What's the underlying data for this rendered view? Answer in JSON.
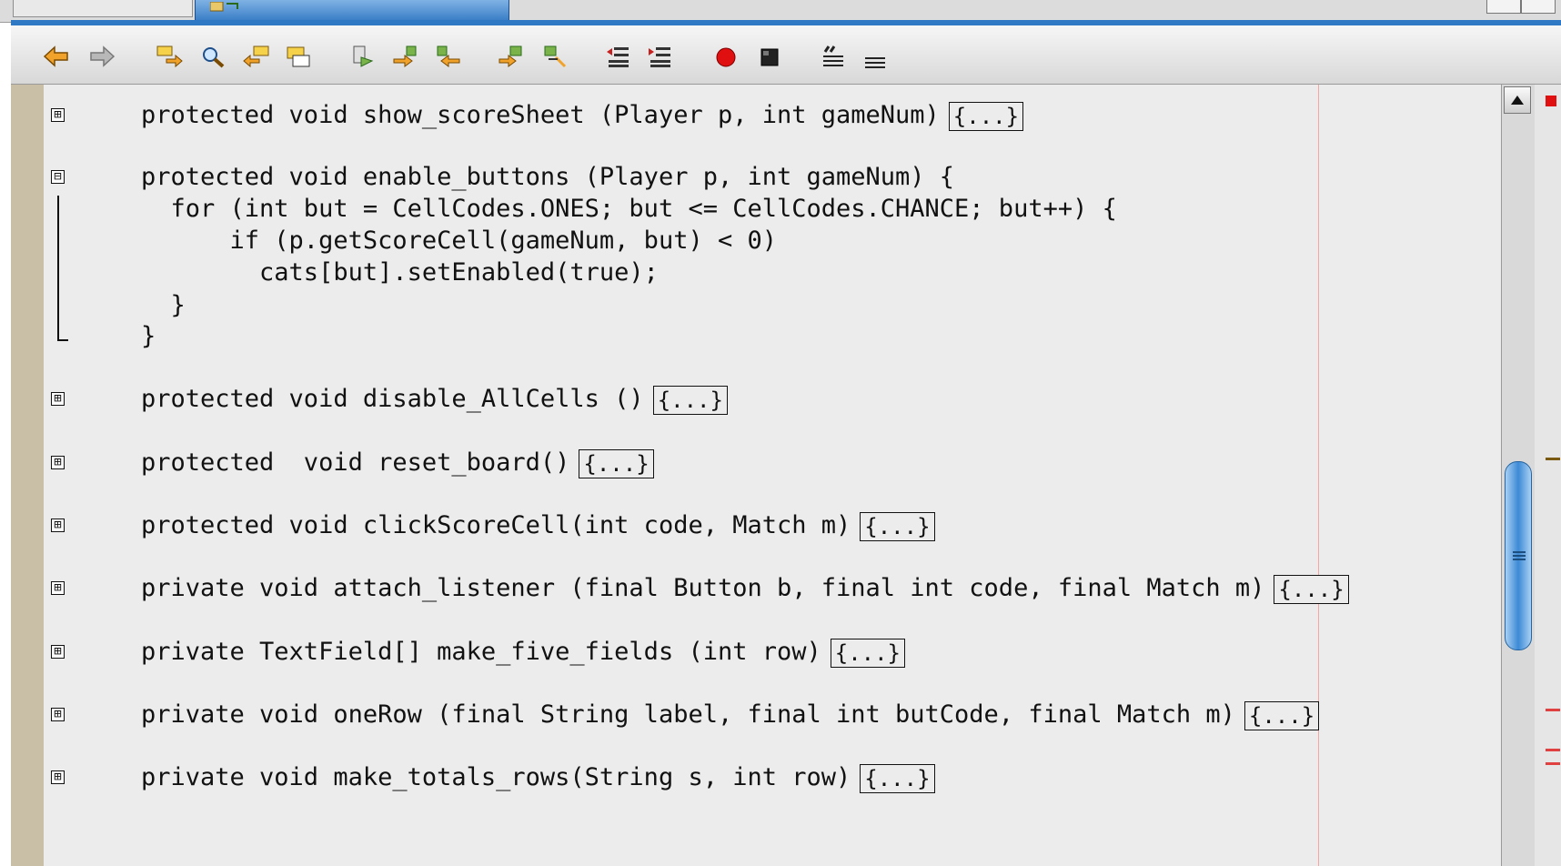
{
  "toolbar": {
    "buttons": [
      {
        "icon": "back-arrow-icon",
        "color": "#e0961a"
      },
      {
        "icon": "forward-arrow-icon",
        "color": "#9a9a9a"
      },
      {
        "icon": "search-next-icon",
        "color": "#e0961a"
      },
      {
        "icon": "find-icon",
        "color": "#e0961a"
      },
      {
        "icon": "search-prev-icon",
        "color": "#e0961a"
      },
      {
        "icon": "toggle-search-icon",
        "color": "#e0961a"
      },
      {
        "icon": "bookmark-icon",
        "color": "#777777"
      },
      {
        "icon": "next-bookmark-icon",
        "color": "#e0961a"
      },
      {
        "icon": "prev-bookmark-icon",
        "color": "#e0961a"
      },
      {
        "icon": "next-usage-icon",
        "color": "#e0961a"
      },
      {
        "icon": "prev-usage-icon",
        "color": "#e0961a"
      },
      {
        "icon": "shift-left-icon",
        "color": "#c62020"
      },
      {
        "icon": "shift-right-icon",
        "color": "#c62020"
      },
      {
        "icon": "record-macro-icon",
        "color": "#e01010"
      },
      {
        "icon": "stop-macro-icon",
        "color": "#222222"
      },
      {
        "icon": "comment-icon",
        "color": "#222222"
      },
      {
        "icon": "uncomment-icon",
        "color": "#222222"
      }
    ]
  },
  "editor": {
    "collapsed_marker": "{...}",
    "lines": [
      {
        "fold": "⊞",
        "text": "protected void show_scoreSheet (Player p, int gameNum)",
        "collapsed": true
      },
      {
        "fold": "⊟",
        "text": "protected void enable_buttons (Player p, int gameNum) {",
        "collapsed": false
      },
      {
        "fold": "",
        "text": "  for (int but = CellCodes.ONES; but <= CellCodes.CHANCE; but++) {",
        "collapsed": false
      },
      {
        "fold": "",
        "text": "      if (p.getScoreCell(gameNum, but) < 0)",
        "collapsed": false
      },
      {
        "fold": "",
        "text": "        cats[but].setEnabled(true);",
        "collapsed": false
      },
      {
        "fold": "",
        "text": "  }",
        "collapsed": false
      },
      {
        "fold": "",
        "text": "}",
        "collapsed": false
      },
      {
        "fold": "⊞",
        "text": "protected void disable_AllCells ()",
        "collapsed": true
      },
      {
        "fold": "⊞",
        "text": "protected  void reset_board()",
        "collapsed": true
      },
      {
        "fold": "⊞",
        "text": "protected void clickScoreCell(int code, Match m)",
        "collapsed": true
      },
      {
        "fold": "⊞",
        "text": "private void attach_listener (final Button b, final int code, final Match m)",
        "collapsed": true
      },
      {
        "fold": "⊞",
        "text": "private TextField[] make_five_fields (int row)",
        "collapsed": true
      },
      {
        "fold": "⊞",
        "text": "private void oneRow (final String label, final int butCode, final Match m)",
        "collapsed": true
      },
      {
        "fold": "⊞",
        "text": "private void make_totals_rows(String s, int row)",
        "collapsed": true
      }
    ]
  },
  "colors": {
    "accent": "#2e78c4",
    "editor_bg": "#ececec",
    "margin": "#c9bea6",
    "right_margin_guide": "#f2a6a6"
  }
}
